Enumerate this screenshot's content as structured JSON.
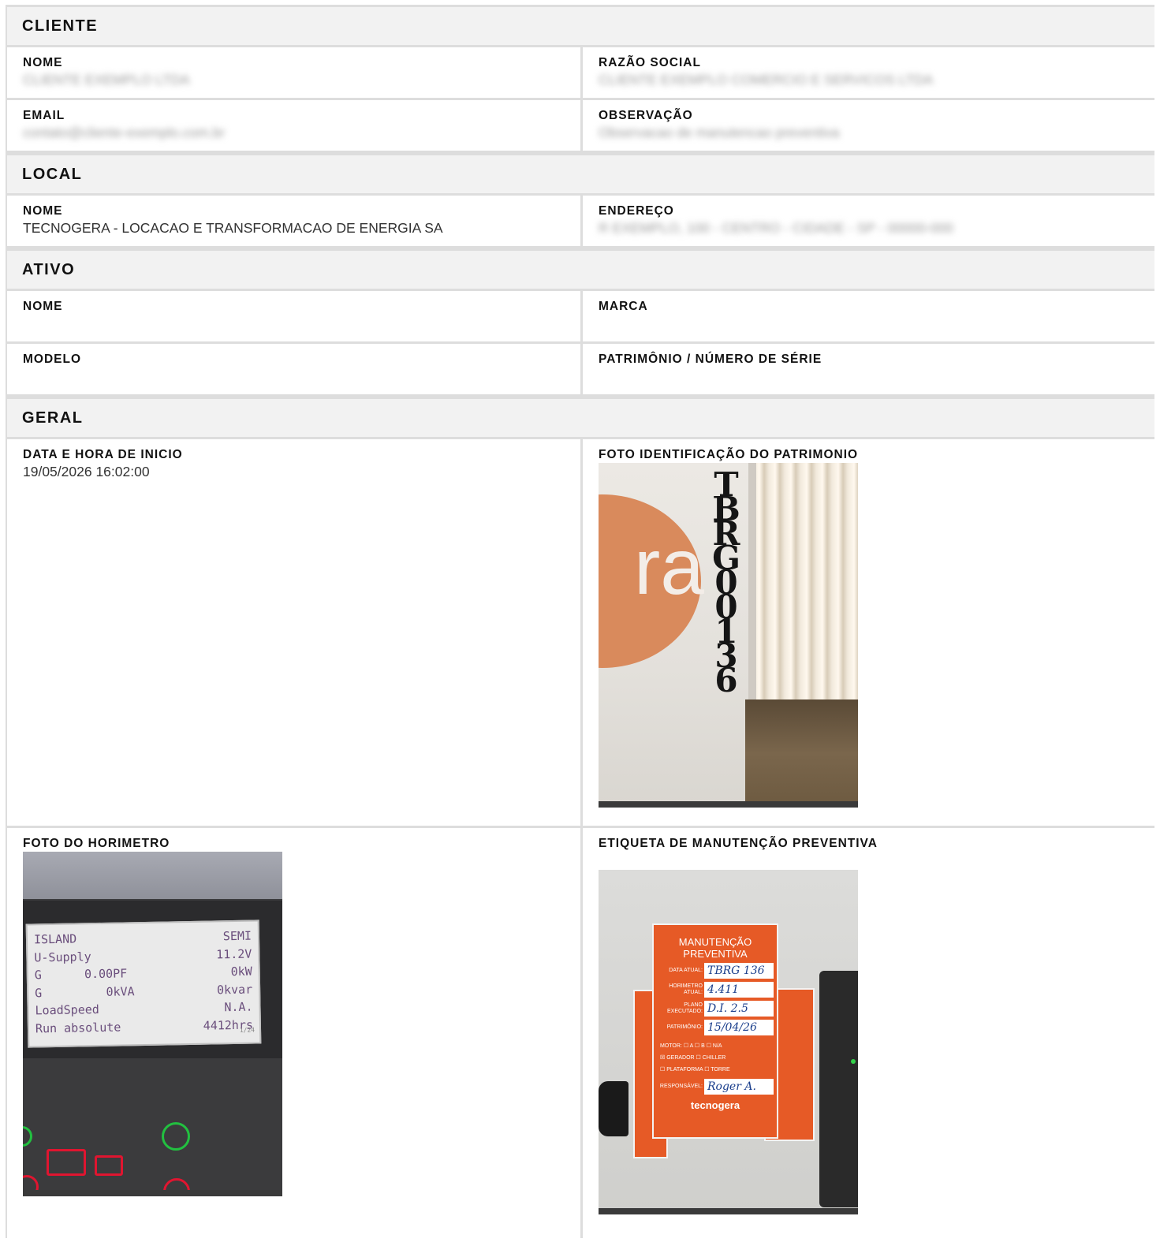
{
  "sections": {
    "cliente": {
      "title": "CLIENTE",
      "nome_label": "NOME",
      "nome_value": "CLIENTE EXEMPLO LTDA",
      "razao_label": "RAZÃO SOCIAL",
      "razao_value": "CLIENTE EXEMPLO COMERCIO E SERVICOS LTDA",
      "email_label": "EMAIL",
      "email_value": "contato@cliente-exemplo.com.br",
      "obs_label": "OBSERVAÇÃO",
      "obs_value": "Observacao de manutencao preventiva"
    },
    "local": {
      "title": "LOCAL",
      "nome_label": "NOME",
      "nome_value": "TECNOGERA - LOCACAO E TRANSFORMACAO DE ENERGIA SA",
      "endereco_label": "ENDEREÇO",
      "endereco_value": "R EXEMPLO, 100 - CENTRO - CIDADE - SP - 00000-000"
    },
    "ativo": {
      "title": "ATIVO",
      "nome_label": "NOME",
      "nome_value": "",
      "marca_label": "MARCA",
      "marca_value": "",
      "modelo_label": "MODELO",
      "modelo_value": "",
      "patrimonio_label": "PATRIMÔNIO / NÚMERO DE SÉRIE",
      "patrimonio_value": ""
    },
    "geral": {
      "title": "GERAL",
      "inicio_label": "DATA E HORA DE INICIO",
      "inicio_value": "19/05/2026 16:02:00",
      "foto_patrimonio_label": "FOTO IDENTIFICAÇÃO DO PATRIMONIO",
      "foto_horimetro_label": "FOTO DO HORIMETRO",
      "etiqueta_label": "ETIQUETA DE MANUTENÇÃO PREVENTIVA"
    }
  },
  "photo_patrimonio": {
    "stencil": [
      "T",
      "B",
      "R",
      "G",
      "0",
      "0",
      "1",
      "3",
      "6"
    ],
    "logo_fragment": "ra"
  },
  "photo_horimetro": {
    "lines": [
      [
        "ISLAND",
        "SEMI"
      ],
      [
        "U-Supply",
        "11.2V"
      ],
      [
        "G      0.00PF",
        "0kW"
      ],
      [
        "G         0kVA",
        "0kvar"
      ],
      [
        "LoadSpeed",
        "N.A."
      ],
      [
        "Run absolute",
        "4412hrs"
      ]
    ],
    "page": "1/24"
  },
  "photo_etiqueta": {
    "title_1": "MANUTENÇÃO",
    "title_2": "PREVENTIVA",
    "fields": [
      {
        "label": "DATA ATUAL:",
        "value": "TBRG 136"
      },
      {
        "label": "HORIMETRO ATUAL:",
        "value": "4.411"
      },
      {
        "label": "PLANO EXECUTADO:",
        "value": "D.I. 2.5"
      },
      {
        "label": "PATRIMÔNIO:",
        "value": "15/04/26"
      }
    ],
    "checks_line1": "MOTOR: ☐ A ☐ B ☐ N/A",
    "checks_line2": "☒ GERADOR    ☐ CHILLER",
    "checks_line3": "☐ PLATAFORMA ☐ TORRE",
    "responsavel_label": "RESPONSÁVEL:",
    "responsavel_value": "Roger A.",
    "logo": "tecnogera"
  }
}
